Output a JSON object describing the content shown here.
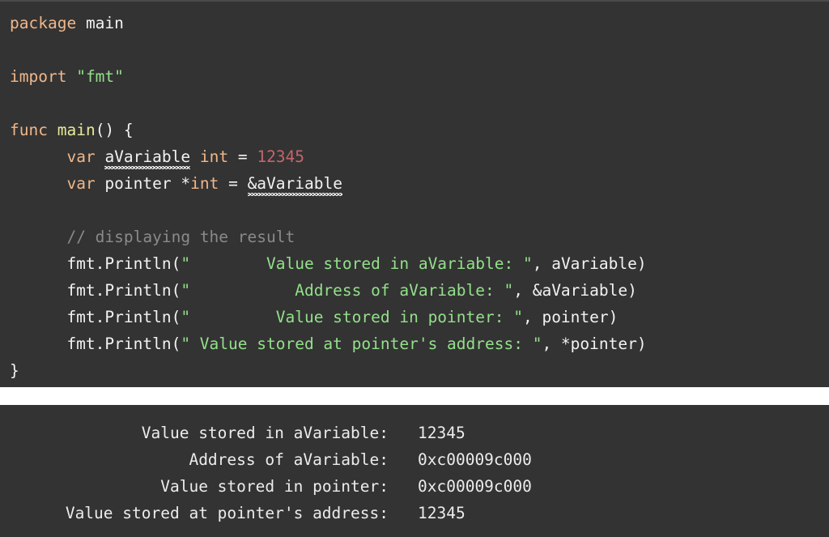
{
  "theme": {
    "editor_background": "#333333",
    "terminal_background": "#333333",
    "divider_background": "#ffffff",
    "keyword_color": "#f0b78a",
    "function_color": "#e8e89a",
    "string_color": "#93e08a",
    "number_color": "#c4656b",
    "comment_color": "#8a8a8a",
    "plain_text_color": "#f2f2f2",
    "spellcheck_underline_color": "#ffffff"
  },
  "editor": {
    "language": "go",
    "lines": [
      {
        "n": 1,
        "tokens": [
          {
            "text": "package",
            "kind": "keyword"
          },
          {
            "text": " ",
            "kind": "plain"
          },
          {
            "text": "main",
            "kind": "plain"
          }
        ]
      },
      {
        "n": 2,
        "tokens": []
      },
      {
        "n": 3,
        "tokens": [
          {
            "text": "import",
            "kind": "keyword"
          },
          {
            "text": " ",
            "kind": "plain"
          },
          {
            "text": "\"fmt\"",
            "kind": "string"
          }
        ]
      },
      {
        "n": 4,
        "tokens": []
      },
      {
        "n": 5,
        "tokens": [
          {
            "text": "func",
            "kind": "keyword"
          },
          {
            "text": " ",
            "kind": "plain"
          },
          {
            "text": "main",
            "kind": "function"
          },
          {
            "text": "() {",
            "kind": "plain"
          }
        ]
      },
      {
        "n": 6,
        "tokens": [
          {
            "text": "      ",
            "kind": "plain"
          },
          {
            "text": "var",
            "kind": "keyword"
          },
          {
            "text": " ",
            "kind": "plain"
          },
          {
            "text": "aVariable",
            "kind": "plain",
            "squiggle": true
          },
          {
            "text": " ",
            "kind": "plain"
          },
          {
            "text": "int",
            "kind": "keyword"
          },
          {
            "text": " = ",
            "kind": "plain"
          },
          {
            "text": "12345",
            "kind": "number"
          }
        ]
      },
      {
        "n": 7,
        "tokens": [
          {
            "text": "      ",
            "kind": "plain"
          },
          {
            "text": "var",
            "kind": "keyword"
          },
          {
            "text": " pointer *",
            "kind": "plain"
          },
          {
            "text": "int",
            "kind": "keyword"
          },
          {
            "text": " = ",
            "kind": "plain"
          },
          {
            "text": "&aVariable",
            "kind": "plain",
            "squiggle": true
          }
        ]
      },
      {
        "n": 8,
        "tokens": []
      },
      {
        "n": 9,
        "tokens": [
          {
            "text": "      ",
            "kind": "plain"
          },
          {
            "text": "// displaying the result",
            "kind": "comment"
          }
        ]
      },
      {
        "n": 10,
        "tokens": [
          {
            "text": "      fmt.Println(",
            "kind": "plain"
          },
          {
            "text": "\"        Value stored in aVariable: \"",
            "kind": "string"
          },
          {
            "text": ", aVariable)",
            "kind": "plain"
          }
        ]
      },
      {
        "n": 11,
        "tokens": [
          {
            "text": "      fmt.Println(",
            "kind": "plain"
          },
          {
            "text": "\"           Address of aVariable: \"",
            "kind": "string"
          },
          {
            "text": ", &aVariable)",
            "kind": "plain"
          }
        ]
      },
      {
        "n": 12,
        "tokens": [
          {
            "text": "      fmt.Println(",
            "kind": "plain"
          },
          {
            "text": "\"         Value stored in pointer: \"",
            "kind": "string"
          },
          {
            "text": ", pointer)",
            "kind": "plain"
          }
        ]
      },
      {
        "n": 13,
        "tokens": [
          {
            "text": "      fmt.Println(",
            "kind": "plain"
          },
          {
            "text": "\" Value stored at pointer's address: \"",
            "kind": "string"
          },
          {
            "text": ", *pointer)",
            "kind": "plain"
          }
        ]
      },
      {
        "n": 14,
        "tokens": [
          {
            "text": "}",
            "kind": "plain"
          }
        ]
      }
    ]
  },
  "output": {
    "rows": [
      {
        "label": "Value stored in aVariable:",
        "value": "12345"
      },
      {
        "label": "Address of aVariable:",
        "value": "0xc00009c000"
      },
      {
        "label": "Value stored in pointer:",
        "value": "0xc00009c000"
      },
      {
        "label": "Value stored at pointer's address:",
        "value": "12345"
      }
    ]
  }
}
